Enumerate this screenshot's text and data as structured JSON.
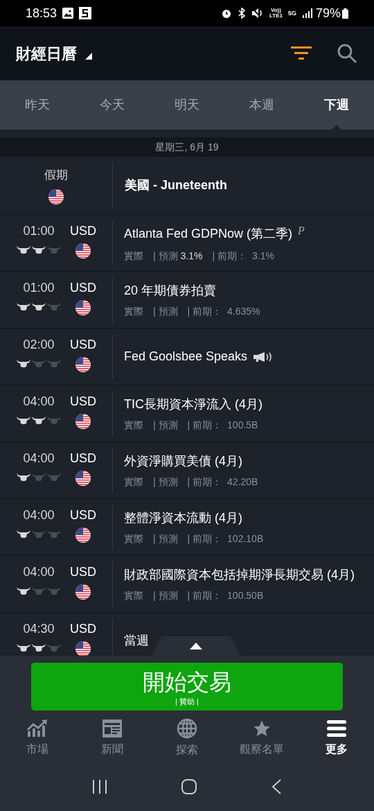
{
  "status_bar": {
    "time": "18:53",
    "network_top": "Vo))",
    "network_bottom": "LTE1",
    "band": "5G",
    "battery": "79%"
  },
  "header": {
    "title": "財經日曆"
  },
  "tabs": [
    {
      "label": "昨天",
      "selected": false
    },
    {
      "label": "今天",
      "selected": false
    },
    {
      "label": "明天",
      "selected": false
    },
    {
      "label": "本週",
      "selected": false
    },
    {
      "label": "下週",
      "selected": true
    }
  ],
  "date_header": "星期三, 6月 19",
  "events": [
    {
      "kind": "holiday",
      "time_label": "假期",
      "title": "美國 - Juneteenth"
    },
    {
      "kind": "event",
      "time": "01:00",
      "currency": "USD",
      "stars": 2,
      "title": "Atlanta Fed GDPNow (第二季)",
      "marker": "P",
      "actual_label": "實際",
      "forecast_label": "| 預測",
      "forecast_value": "3.1%",
      "previous_label": "| 前期：",
      "previous_value": "3.1%"
    },
    {
      "kind": "event",
      "time": "01:00",
      "currency": "USD",
      "stars": 2,
      "title": "20 年期債券拍賣",
      "actual_label": "實際",
      "forecast_label": "| 預測",
      "previous_label": "| 前期：",
      "previous_value": "4.635%"
    },
    {
      "kind": "speech",
      "time": "02:00",
      "currency": "USD",
      "stars": 1,
      "title": "Fed Goolsbee Speaks"
    },
    {
      "kind": "event",
      "time": "04:00",
      "currency": "USD",
      "stars": 2,
      "title": "TIC長期資本淨流入 (4月)",
      "actual_label": "實際",
      "forecast_label": "| 預測",
      "previous_label": "| 前期：",
      "previous_value": "100.5B"
    },
    {
      "kind": "event",
      "time": "04:00",
      "currency": "USD",
      "stars": 1,
      "title": "外資淨購買美債 (4月)",
      "actual_label": "實際",
      "forecast_label": "| 預測",
      "previous_label": "| 前期：",
      "previous_value": "42.20B"
    },
    {
      "kind": "event",
      "time": "04:00",
      "currency": "USD",
      "stars": 1,
      "title": "整體淨資本流動 (4月)",
      "actual_label": "實際",
      "forecast_label": "| 預測",
      "previous_label": "| 前期：",
      "previous_value": "102.10B"
    },
    {
      "kind": "event",
      "time": "04:00",
      "currency": "USD",
      "stars": 1,
      "title": "財政部國際資本包括掉期淨長期交易 (4月)",
      "actual_label": "實際",
      "forecast_label": "| 預測",
      "previous_label": "| 前期：",
      "previous_value": "100.50B"
    },
    {
      "kind": "event",
      "time": "04:30",
      "currency": "USD",
      "stars": 2,
      "title": "當週"
    }
  ],
  "trade_button": {
    "label": "開始交易",
    "sponsor": "| 贊助 |"
  },
  "bottom_nav": [
    {
      "label": "市場",
      "selected": false
    },
    {
      "label": "新聞",
      "selected": false
    },
    {
      "label": "探索",
      "selected": false
    },
    {
      "label": "觀察名單",
      "selected": false
    },
    {
      "label": "更多",
      "selected": true
    }
  ]
}
